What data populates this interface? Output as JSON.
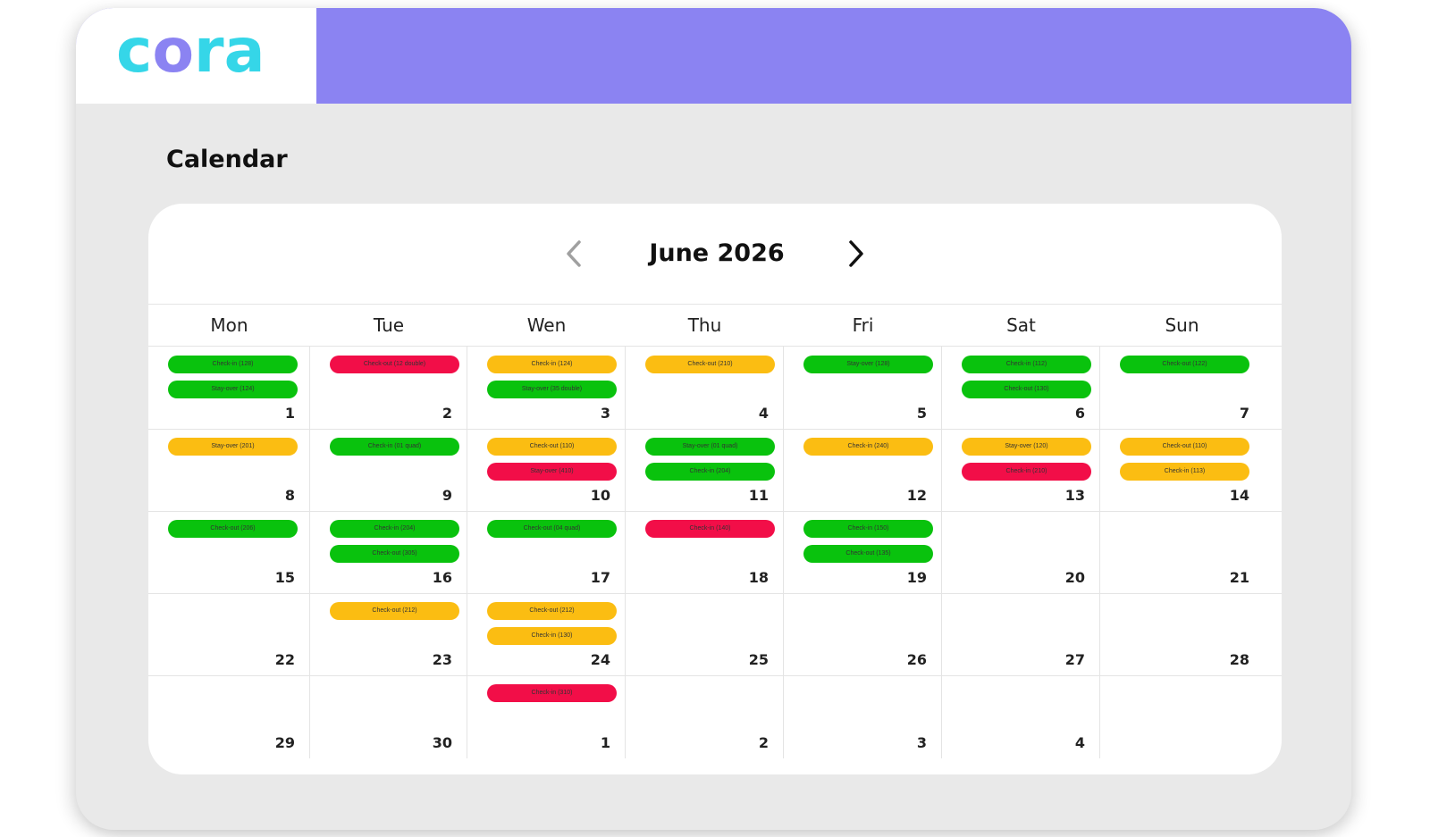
{
  "app": {
    "logo_text": "cora",
    "colors": {
      "header": "#8b83f2",
      "logo": "#35d6e8",
      "logo_o": "#8b83f2"
    }
  },
  "page": {
    "title": "Calendar"
  },
  "calendar": {
    "month_label": "June 2026",
    "prev_icon": "chevron-left-icon",
    "next_icon": "chevron-right-icon",
    "weekdays": [
      "Mon",
      "Tue",
      "Wen",
      "Thu",
      "Fri",
      "Sat",
      "Sun"
    ],
    "status_colors": {
      "green": "#09c20d",
      "yellow": "#fbbd12",
      "red": "#f20e48"
    },
    "weeks": [
      {
        "days": [
          {
            "num": "1",
            "events": [
              {
                "label": "Check-in (128)",
                "color": "green"
              },
              {
                "label": "Stay-over (124)",
                "color": "green"
              }
            ]
          },
          {
            "num": "2",
            "events": [
              {
                "label": "Check-out (12 double)",
                "color": "red"
              }
            ]
          },
          {
            "num": "3",
            "events": [
              {
                "label": "Check-in (124)",
                "color": "yellow"
              },
              {
                "label": "Stay-over (35 double)",
                "color": "green"
              }
            ]
          },
          {
            "num": "4",
            "events": [
              {
                "label": "Check-out (210)",
                "color": "yellow"
              }
            ]
          },
          {
            "num": "5",
            "events": [
              {
                "label": "Stay-over (128)",
                "color": "green"
              }
            ]
          },
          {
            "num": "6",
            "events": [
              {
                "label": "Check-in (112)",
                "color": "green"
              },
              {
                "label": "Check-out (130)",
                "color": "green"
              }
            ]
          },
          {
            "num": "7",
            "events": [
              {
                "label": "Check-out (122)",
                "color": "green"
              }
            ]
          }
        ]
      },
      {
        "days": [
          {
            "num": "8",
            "events": [
              {
                "label": "Stay-over (201)",
                "color": "yellow"
              }
            ]
          },
          {
            "num": "9",
            "events": [
              {
                "label": "Check-in (01 quad)",
                "color": "green"
              }
            ]
          },
          {
            "num": "10",
            "events": [
              {
                "label": "Check-out (110)",
                "color": "yellow"
              },
              {
                "label": "Stay-over (410)",
                "color": "red"
              }
            ]
          },
          {
            "num": "11",
            "events": [
              {
                "label": "Stay-over (01 quad)",
                "color": "green"
              },
              {
                "label": "Check-in (204)",
                "color": "green"
              }
            ]
          },
          {
            "num": "12",
            "events": [
              {
                "label": "Check-in (240)",
                "color": "yellow"
              }
            ]
          },
          {
            "num": "13",
            "events": [
              {
                "label": "Stay-over (120)",
                "color": "yellow"
              },
              {
                "label": "Check-in (210)",
                "color": "red"
              }
            ]
          },
          {
            "num": "14",
            "events": [
              {
                "label": "Check-out (110)",
                "color": "yellow"
              },
              {
                "label": "Check-in (113)",
                "color": "yellow"
              }
            ]
          }
        ]
      },
      {
        "days": [
          {
            "num": "15",
            "events": [
              {
                "label": "Check-out (206)",
                "color": "green"
              }
            ]
          },
          {
            "num": "16",
            "events": [
              {
                "label": "Check-in (204)",
                "color": "green"
              },
              {
                "label": "Check-out (305)",
                "color": "green"
              }
            ]
          },
          {
            "num": "17",
            "events": [
              {
                "label": "Check-out (04 quad)",
                "color": "green"
              }
            ]
          },
          {
            "num": "18",
            "events": [
              {
                "label": "Check-in (140)",
                "color": "red"
              }
            ]
          },
          {
            "num": "19",
            "events": [
              {
                "label": "Check-in (150)",
                "color": "green"
              },
              {
                "label": "Check-out (135)",
                "color": "green"
              }
            ]
          },
          {
            "num": "20",
            "events": []
          },
          {
            "num": "21",
            "events": []
          }
        ]
      },
      {
        "days": [
          {
            "num": "22",
            "events": []
          },
          {
            "num": "23",
            "events": [
              {
                "label": "Check-out (212)",
                "color": "yellow"
              }
            ]
          },
          {
            "num": "24",
            "events": [
              {
                "label": "Check-out (212)",
                "color": "yellow"
              },
              {
                "label": "Check-in (130)",
                "color": "yellow"
              }
            ]
          },
          {
            "num": "25",
            "events": []
          },
          {
            "num": "26",
            "events": []
          },
          {
            "num": "27",
            "events": []
          },
          {
            "num": "28",
            "events": []
          }
        ]
      },
      {
        "days": [
          {
            "num": "29",
            "events": []
          },
          {
            "num": "30",
            "events": []
          },
          {
            "num": "1",
            "events": [
              {
                "label": "Check-in (310)",
                "color": "red"
              }
            ]
          },
          {
            "num": "2",
            "events": []
          },
          {
            "num": "3",
            "events": []
          },
          {
            "num": "4",
            "events": []
          },
          {
            "num": "",
            "events": []
          }
        ]
      }
    ]
  }
}
